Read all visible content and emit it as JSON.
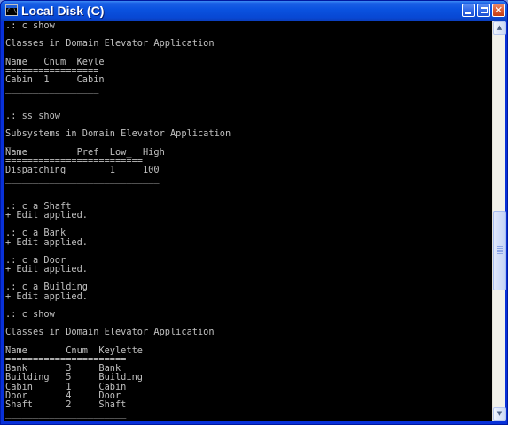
{
  "window": {
    "title": "Local Disk (C)",
    "icon": "console-icon",
    "controls": {
      "minimize": "minimize-icon",
      "maximize": "maximize-icon",
      "close": "close-icon"
    }
  },
  "scrollbar": {
    "position": 0.6
  },
  "console": {
    "lines": [
      ".: c show",
      "",
      "Classes in Domain Elevator Application",
      "_",
      "Name   Cnum  Keyle",
      "=================",
      "Cabin  1     Cabin",
      "_________________",
      "",
      "",
      ".: ss show",
      "",
      "Subsystems in Domain Elevator Application",
      "_",
      "Name         Pref  Low_  High",
      "=========================",
      "Dispatching        1     100",
      "____________________________",
      "",
      "",
      ".: c a Shaft",
      "+ Edit applied.",
      "",
      ".: c a Bank",
      "+ Edit applied.",
      "",
      ".: c a Door",
      "+ Edit applied.",
      "",
      ".: c a Building",
      "+ Edit applied.",
      "",
      ".: c show",
      "",
      "Classes in Domain Elevator Application",
      "_",
      "Name       Cnum  Keylette",
      "======================",
      "Bank       3     Bank",
      "Building   5     Building",
      "Cabin      1     Cabin",
      "Door       4     Door",
      "Shaft      2     Shaft",
      "______________________",
      "",
      "",
      ".:"
    ]
  }
}
